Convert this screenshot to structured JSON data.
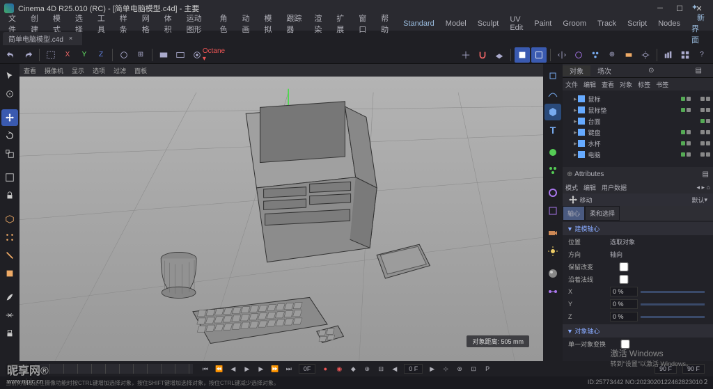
{
  "title": "Cinema 4D R25.010 (RC) - [简单电脑模型.c4d] - 主要",
  "tab": {
    "name": "简单电脑模型.c4d",
    "close": "×"
  },
  "menu": [
    "文件",
    "创建",
    "模式",
    "选择",
    "工具",
    "样条",
    "网格",
    "体积",
    "运动图形",
    "角色",
    "动画",
    "模拟",
    "跟踪器",
    "渲染",
    "扩展",
    "窗口",
    "帮助"
  ],
  "menu_right": {
    "std": "Standard",
    "items": [
      "Model",
      "Sculpt",
      "UV Edit",
      "Paint",
      "Groom",
      "Track",
      "Script",
      "Nodes"
    ],
    "new": "新界面"
  },
  "viewport": {
    "menus": [
      "查看",
      "摄像机",
      "显示",
      "选项",
      "过滤",
      "面板"
    ],
    "stat": "对象距离: 505 mm"
  },
  "panels": {
    "obj_tabs": [
      "对象",
      "场次"
    ],
    "obj_sub": [
      "文件",
      "编辑",
      "查看",
      "对象",
      "标签",
      "书签"
    ],
    "objects": [
      {
        "name": "鼠标",
        "ico": "#6af"
      },
      {
        "name": "鼠标垫",
        "ico": "#6af"
      },
      {
        "name": "台面",
        "ico": "#6af"
      },
      {
        "name": "键盘",
        "ico": "#6af"
      },
      {
        "name": "水杯",
        "ico": "#6af"
      },
      {
        "name": "电脑",
        "ico": "#6af"
      }
    ],
    "attr_hdr": "Attributes",
    "attr_sub": [
      "模式",
      "编辑",
      "用户数据"
    ],
    "tool_row": "移动",
    "tool_opt": "默认",
    "tool_tabs": [
      "轴心",
      "柔和选择"
    ],
    "sect1": "▼ 建模轴心",
    "rows": [
      {
        "l": "位置",
        "v": "选取对象"
      },
      {
        "l": "方向",
        "v": "轴向"
      },
      {
        "l": "保留改变",
        "v": ""
      },
      {
        "l": "沿着法线",
        "v": ""
      }
    ],
    "axes": [
      {
        "l": "X",
        "v": "0 %"
      },
      {
        "l": "Y",
        "v": "0 %"
      },
      {
        "l": "Z",
        "v": "0 %"
      }
    ],
    "sect2": "▼ 对象轴心",
    "row2": "单一对象变换"
  },
  "timeline": {
    "start": "0 F",
    "cur": "0F",
    "end": "90 F",
    "end2": "90 F"
  },
  "status": "当前对象或正在摄像功能时按CTRL键增加选择对象，按住SHIFT键增加选择对象，按住CTRL键减少选择对象。",
  "winact": {
    "t": "激活 Windows",
    "s": "转到\"设置\"以激活 Windows。"
  },
  "wm": {
    "t": "昵享网",
    "s": "www.nipic.cn"
  },
  "imgid": "ID:25773442 NO:2023020122462823010２"
}
